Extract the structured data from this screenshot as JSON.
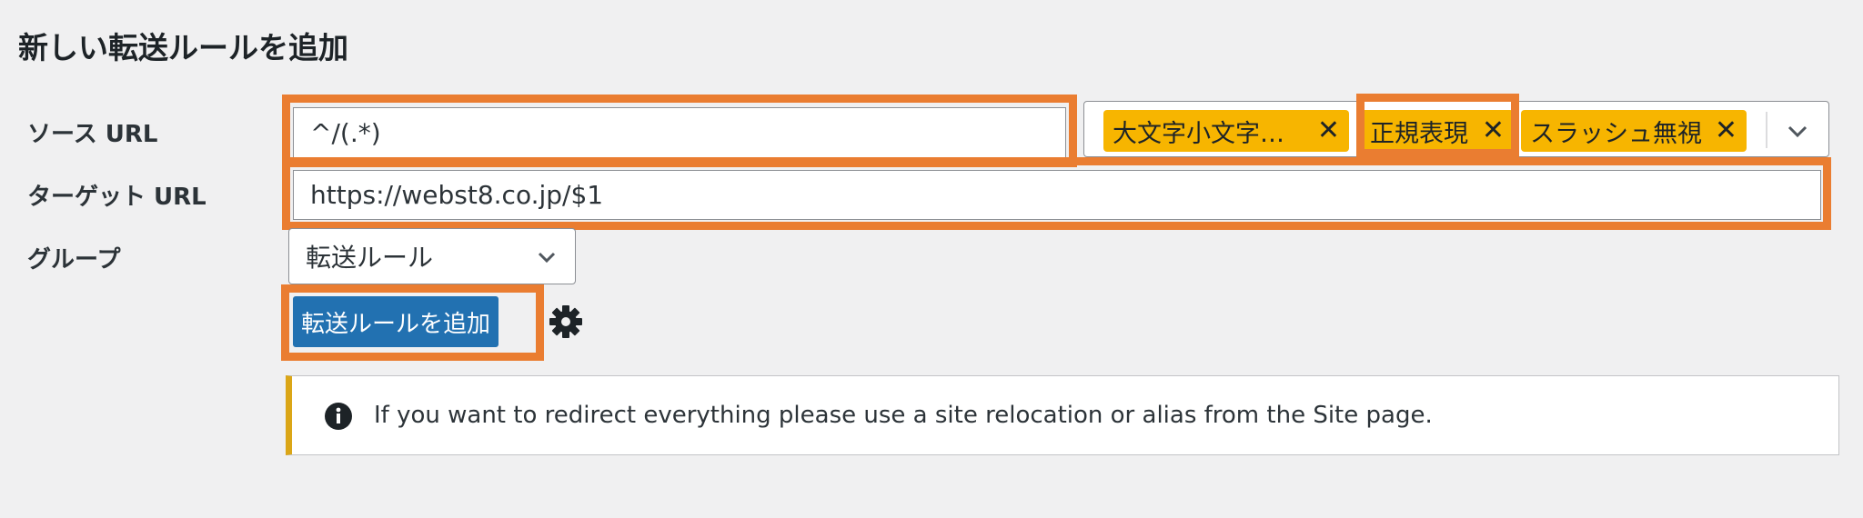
{
  "page_title": "新しい転送ルールを追加",
  "source": {
    "label": "ソース URL",
    "value": "^/(.*)"
  },
  "flags": {
    "chips": [
      {
        "label": "大文字小文字…",
        "remove_glyph": "✕"
      },
      {
        "label": "正規表現",
        "remove_glyph": "✕"
      },
      {
        "label": "スラッシュ無視",
        "remove_glyph": "✕"
      }
    ],
    "dropdown_icon": "chevron-down-icon"
  },
  "target": {
    "label": "ターゲット URL",
    "value": "https://webst8.co.jp/$1"
  },
  "group": {
    "label": "グループ",
    "selected": "転送ルール",
    "icon": "chevron-down-icon"
  },
  "actions": {
    "add_button_label": "転送ルールを追加",
    "options_icon": "gear-icon"
  },
  "notice": {
    "icon": "info-icon",
    "message": "If you want to redirect everything please use a site relocation or alias from the Site page."
  },
  "colors": {
    "highlight": "#ea7d31",
    "chip": "#f7b500",
    "primary": "#2271b1",
    "notice_accent": "#dba617",
    "background": "#f0f0f1"
  }
}
